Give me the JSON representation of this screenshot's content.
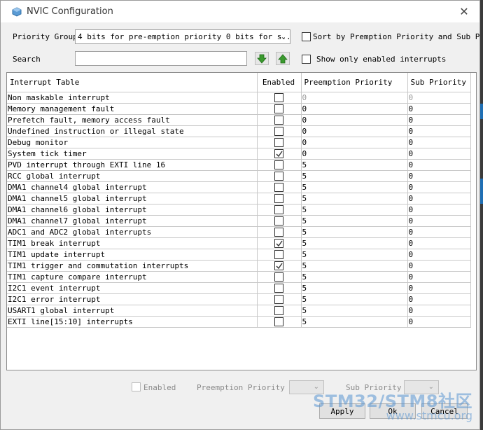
{
  "window": {
    "title": "NVIC Configuration"
  },
  "controls": {
    "priority_group_label": "Priority Group",
    "priority_group_value": "4 bits for pre-emption priority 0 bits for s...",
    "sort_label": "Sort by Premption Priority and Sub Priority",
    "search_label": "Search",
    "search_value": "",
    "show_only_enabled_label": "Show only enabled interrupts"
  },
  "table": {
    "columns": [
      "Interrupt Table",
      "Enabled",
      "Preemption Priority",
      "Sub Priority"
    ],
    "rows": [
      {
        "name": "Non maskable interrupt",
        "enabled": false,
        "preemption": "0",
        "sub": "0",
        "muted": true
      },
      {
        "name": "Memory management fault",
        "enabled": false,
        "preemption": "0",
        "sub": "0"
      },
      {
        "name": "Prefetch fault, memory access fault",
        "enabled": false,
        "preemption": "0",
        "sub": "0"
      },
      {
        "name": "Undefined instruction or illegal state",
        "enabled": false,
        "preemption": "0",
        "sub": "0"
      },
      {
        "name": "Debug monitor",
        "enabled": false,
        "preemption": "0",
        "sub": "0"
      },
      {
        "name": "System tick timer",
        "enabled": true,
        "preemption": "0",
        "sub": "0"
      },
      {
        "name": "PVD interrupt through EXTI line 16",
        "enabled": false,
        "preemption": "5",
        "sub": "0"
      },
      {
        "name": "RCC global interrupt",
        "enabled": false,
        "preemption": "5",
        "sub": "0"
      },
      {
        "name": "DMA1 channel4 global interrupt",
        "enabled": false,
        "preemption": "5",
        "sub": "0"
      },
      {
        "name": "DMA1 channel5 global interrupt",
        "enabled": false,
        "preemption": "5",
        "sub": "0"
      },
      {
        "name": "DMA1 channel6 global interrupt",
        "enabled": false,
        "preemption": "5",
        "sub": "0"
      },
      {
        "name": "DMA1 channel7 global interrupt",
        "enabled": false,
        "preemption": "5",
        "sub": "0"
      },
      {
        "name": "ADC1 and ADC2 global interrupts",
        "enabled": false,
        "preemption": "5",
        "sub": "0"
      },
      {
        "name": "TIM1 break interrupt",
        "enabled": true,
        "preemption": "5",
        "sub": "0"
      },
      {
        "name": "TIM1 update interrupt",
        "enabled": false,
        "preemption": "5",
        "sub": "0"
      },
      {
        "name": "TIM1 trigger and commutation interrupts",
        "enabled": true,
        "preemption": "5",
        "sub": "0"
      },
      {
        "name": "TIM1 capture compare interrupt",
        "enabled": false,
        "preemption": "5",
        "sub": "0"
      },
      {
        "name": "I2C1 event interrupt",
        "enabled": false,
        "preemption": "5",
        "sub": "0"
      },
      {
        "name": "I2C1 error interrupt",
        "enabled": false,
        "preemption": "5",
        "sub": "0"
      },
      {
        "name": "USART1 global interrupt",
        "enabled": false,
        "preemption": "5",
        "sub": "0"
      },
      {
        "name": "EXTI line[15:10] interrupts",
        "enabled": false,
        "preemption": "5",
        "sub": "0"
      }
    ]
  },
  "bottom": {
    "enabled_label": "Enabled",
    "preemption_label": "Preemption Priority",
    "sub_label": "Sub Priority",
    "apply": "Apply",
    "ok": "Ok",
    "cancel": "Cancel"
  },
  "watermark": {
    "line1": "STM32/STM8社区",
    "line2": "www.stmcu.org"
  },
  "colors": {
    "accent_blue": "#1f6fb4",
    "arrow_green": "#3a9a2e",
    "check": "#333333"
  },
  "icons": [
    "app-cube-icon",
    "close-icon",
    "chevron-down-icon",
    "arrow-down-icon",
    "arrow-up-icon",
    "checkmark-icon"
  ]
}
